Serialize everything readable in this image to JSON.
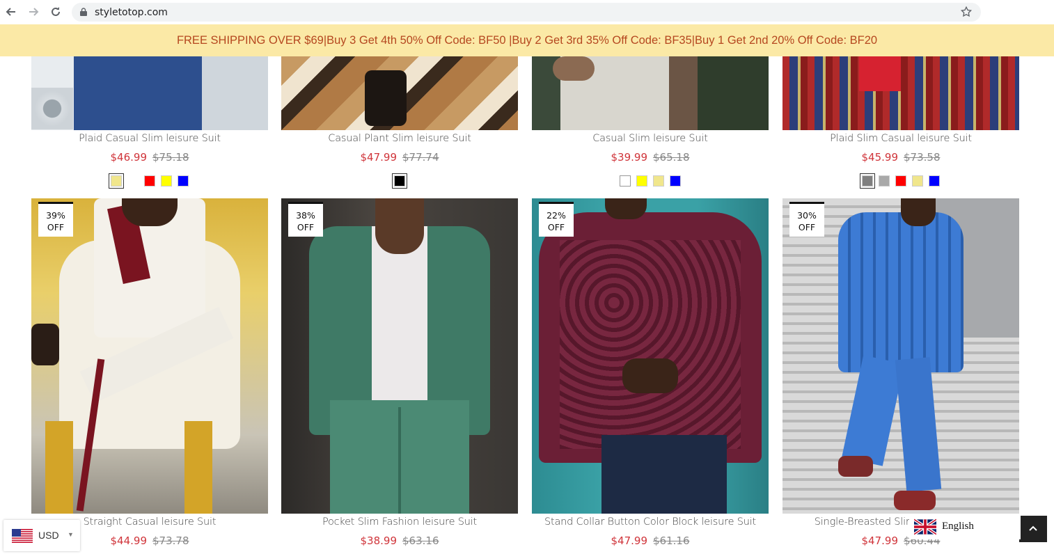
{
  "browser": {
    "url": "styletotop.com"
  },
  "banner": {
    "text": "FREE SHIPPING OVER $69|Buy 3 Get 4th 50% Off Code: BF50 |Buy 2 Get 3rd 35% Off Code: BF35|Buy 1 Get 2nd 20% Off Code: BF20"
  },
  "row1": [
    {
      "name": "Plaid Casual Slim leisure Suit",
      "price": "$46.99",
      "was": "$75.18",
      "swatches": [
        "#f0e68c",
        "#ffffff",
        "#ff0000",
        "#ffff00",
        "#0000ff"
      ]
    },
    {
      "name": "Casual Plant Slim leisure Suit",
      "price": "$47.99",
      "was": "$77.74",
      "swatches": [
        "#000000"
      ]
    },
    {
      "name": "Casual Slim leisure Suit",
      "price": "$39.99",
      "was": "$65.18",
      "swatches": [
        "#ffffff",
        "#ffff00",
        "#f0e68c",
        "#0000ff"
      ]
    },
    {
      "name": "Plaid Slim Casual leisure Suit",
      "price": "$45.99",
      "was": "$73.58",
      "swatches": [
        "#808080",
        "#a9a9a9",
        "#ff0000",
        "#f0e68c",
        "#0000ff"
      ]
    }
  ],
  "row2": [
    {
      "badge_pct": "39%",
      "badge_off": "OFF",
      "name": "Straight Casual leisure Suit",
      "price": "$44.99",
      "was": "$73.78"
    },
    {
      "badge_pct": "38%",
      "badge_off": "OFF",
      "name": "Pocket Slim Fashion leisure Suit",
      "price": "$38.99",
      "was": "$63.16"
    },
    {
      "badge_pct": "22%",
      "badge_off": "OFF",
      "name": "Stand Collar Button Color Block leisure Suit",
      "price": "$47.99",
      "was": "$61.16"
    },
    {
      "badge_pct": "30%",
      "badge_off": "OFF",
      "name": "Single-Breasted Slim E",
      "price": "$47.99",
      "was": "$60.44"
    }
  ],
  "currency": {
    "code": "USD"
  },
  "language": {
    "label": "English"
  },
  "colors": {
    "banner_bg": "#fbe9a6",
    "banner_text": "#b5471f",
    "price": "#d0343a"
  }
}
